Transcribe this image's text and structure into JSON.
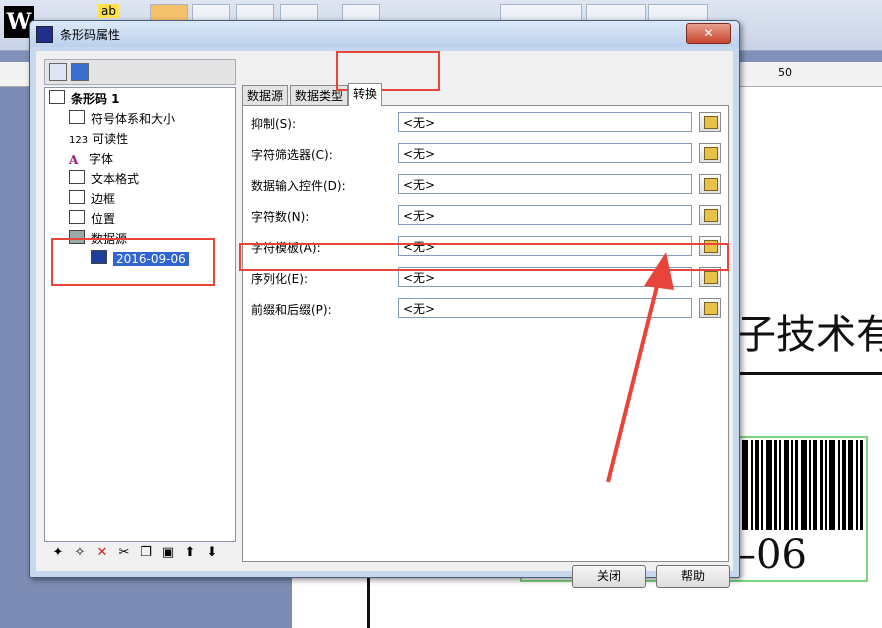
{
  "dialog": {
    "title": "条形码属性",
    "close_glyph": "✕",
    "tabs": [
      "数据源",
      "数据类型",
      "转换"
    ],
    "tree": {
      "root": "条形码 1",
      "items": [
        "符号体系和大小",
        "可读性",
        "字体",
        "文本格式",
        "边框",
        "位置",
        "数据源"
      ],
      "selected_child": "2016-09-06"
    },
    "rows": [
      {
        "label": "抑制(S):",
        "value": "<无>"
      },
      {
        "label": "字符筛选器(C):",
        "value": "<无>"
      },
      {
        "label": "数据输入控件(D):",
        "value": "<无>"
      },
      {
        "label": "字符数(N):",
        "value": "<无>"
      },
      {
        "label": "字符模板(A):",
        "value": "<无>"
      },
      {
        "label": "序列化(E):",
        "value": "<无>"
      },
      {
        "label": "前缀和后缀(P):",
        "value": "<无>"
      }
    ],
    "buttons": {
      "close": "关闭",
      "help": "帮助"
    },
    "tree_icon_labels": {
      "readability": "123"
    }
  },
  "background": {
    "toolbar_logo": "W",
    "toolbar_ab": "ab",
    "ruler_label": "50",
    "company_text": "子技术有",
    "barcode_date_suffix": "–06"
  },
  "colors": {
    "annotation": "#e8443a",
    "selection": "#3064d0",
    "barcode_frame": "#7ed37e"
  }
}
